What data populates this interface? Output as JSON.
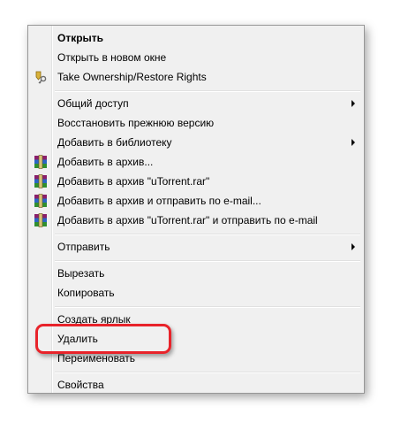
{
  "menu": {
    "open": "Открыть",
    "open_new_window": "Открыть в новом окне",
    "take_ownership": "Take Ownership/Restore Rights",
    "sharing": "Общий доступ",
    "restore_previous": "Восстановить прежнюю версию",
    "add_to_library": "Добавить в библиотеку",
    "add_to_archive": "Добавить в архив...",
    "add_to_archive_named": "Добавить в архив \"uTorrent.rar\"",
    "add_and_email": "Добавить в архив и отправить по e-mail...",
    "add_named_and_email": "Добавить в архив \"uTorrent.rar\" и отправить по e-mail",
    "send_to": "Отправить",
    "cut": "Вырезать",
    "copy": "Копировать",
    "create_shortcut": "Создать ярлык",
    "delete": "Удалить",
    "rename": "Переименовать",
    "properties": "Свойства"
  },
  "icons": {
    "ownership": "key-shield-icon",
    "archive": "winrar-icon"
  },
  "colors": {
    "highlight": "#e8232a",
    "menu_bg": "#f0f0f0"
  }
}
